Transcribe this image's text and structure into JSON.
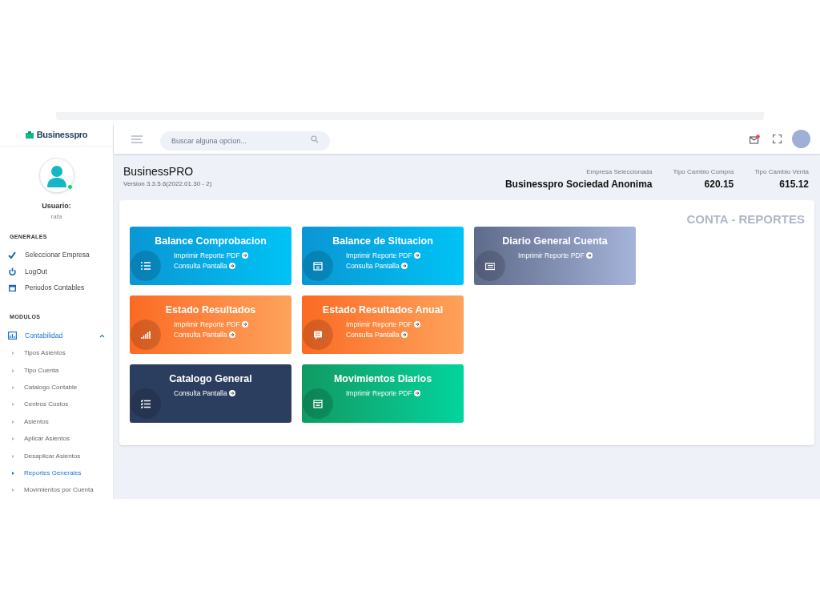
{
  "brand": "Businesspro",
  "search": {
    "placeholder": "Buscar alguna opcion..."
  },
  "user": {
    "label": "Usuario:",
    "name": "rafa",
    "online": true
  },
  "notifications": {
    "unread": true
  },
  "sidebar": {
    "sections": [
      {
        "title": "GENERALES",
        "items": [
          {
            "label": "Seleccionar Empresa"
          },
          {
            "label": "LogOut"
          },
          {
            "label": "Periodos Contables"
          }
        ]
      },
      {
        "title": "MODULOS",
        "items": [
          {
            "label": "Contabilidad",
            "expanded": true,
            "children": [
              {
                "label": "Tipos Asientos",
                "selected": false
              },
              {
                "label": "Tipo Cuenta",
                "selected": false
              },
              {
                "label": "Catalogo Contable",
                "selected": false
              },
              {
                "label": "Centros Costos",
                "selected": false
              },
              {
                "label": "Asientos",
                "selected": false
              },
              {
                "label": "Aplicar Asientos",
                "selected": false
              },
              {
                "label": "Desaplicar Asientos",
                "selected": false
              },
              {
                "label": "Reportes Generales",
                "selected": true
              },
              {
                "label": "Movimientos por Cuenta",
                "selected": false
              }
            ]
          }
        ]
      }
    ]
  },
  "app": {
    "title": "BusinessPRO",
    "version": "Version 3.3.5.6(2022.01.30 - 2)"
  },
  "stats": [
    {
      "label": "Empresa Seleccionada",
      "value": "Businesspro Sociedad Anonima"
    },
    {
      "label": "Tipo Cambio Compra",
      "value": "620.15"
    },
    {
      "label": "Tipo Cambio Venta",
      "value": "615.12"
    }
  ],
  "panel": {
    "title": "CONTA - REPORTES",
    "rows": [
      {
        "cards": [
          {
            "title": "Balance Comprobacion",
            "kind": "info",
            "links": [
              "Imprimir Reporte PDF",
              "Consulta Pantalla"
            ]
          },
          {
            "title": "Balance de Situacion",
            "kind": "info",
            "links": [
              "Imprimir Reporte PDF",
              "Consulta Pantalla"
            ]
          },
          {
            "title": "Diario General Cuenta",
            "kind": "slate",
            "links": [
              "Imprimir Reporte PDF"
            ]
          }
        ]
      },
      {
        "cards": [
          {
            "title": "Estado Resultados",
            "kind": "warning",
            "links": [
              "Imprimir Reporte PDF",
              "Consulta Pantalla"
            ]
          },
          {
            "title": "Estado Resultados Anual",
            "kind": "warning",
            "links": [
              "Imprimir Reporte PDF",
              "Consulta Pantalla"
            ]
          }
        ]
      },
      {
        "cards": [
          {
            "title": "Catalogo General",
            "kind": "dark",
            "links": [
              "Consulta Pantalla"
            ]
          },
          {
            "title": "Movimientos Diarios",
            "kind": "success",
            "links": [
              "Imprimir Reporte PDF"
            ]
          }
        ]
      }
    ]
  }
}
